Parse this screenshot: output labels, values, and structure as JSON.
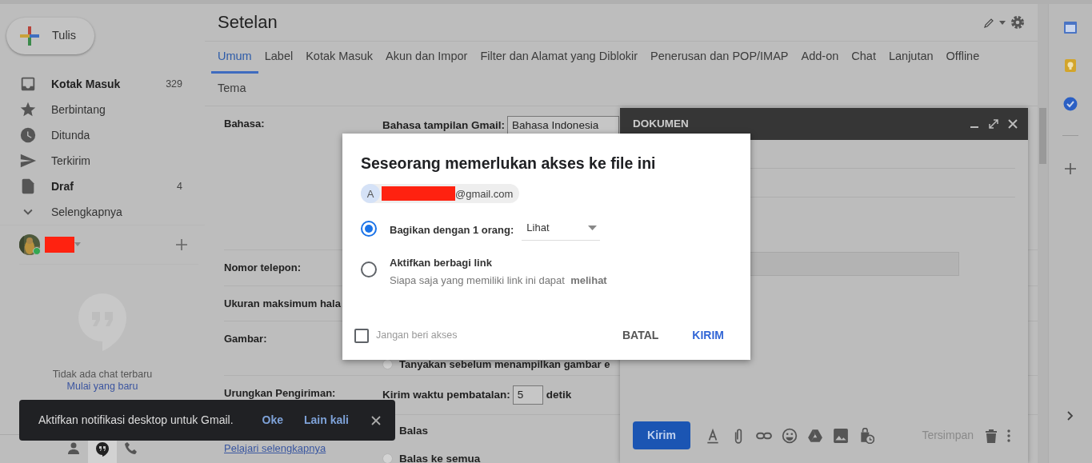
{
  "sidebar": {
    "compose_button": "Tulis",
    "items": [
      {
        "kind": "inbox",
        "label": "Kotak Masuk",
        "count": "329",
        "unread": true
      },
      {
        "kind": "star",
        "label": "Berbintang",
        "unread": false
      },
      {
        "kind": "clock",
        "label": "Ditunda",
        "unread": false
      },
      {
        "kind": "send",
        "label": "Terkirim",
        "unread": false
      },
      {
        "kind": "draft",
        "label": "Draf",
        "count": "4",
        "unread": true
      },
      {
        "kind": "more",
        "label": "Selengkapnya",
        "unread": false
      }
    ],
    "hangouts": {
      "empty_text": "Tidak ada chat terbaru",
      "start_link": "Mulai yang baru"
    },
    "bottom_tabs": [
      {
        "kind": "people",
        "selected": false
      },
      {
        "kind": "chat",
        "selected": true
      },
      {
        "kind": "phone",
        "selected": false
      }
    ]
  },
  "settings": {
    "title": "Setelan",
    "tabs": [
      {
        "label": "Umum",
        "selected": true
      },
      {
        "label": "Label",
        "selected": false
      },
      {
        "label": "Kotak Masuk",
        "selected": false
      },
      {
        "label": "Akun dan Impor",
        "selected": false
      },
      {
        "label": "Filter dan Alamat yang Diblokir",
        "selected": false
      },
      {
        "label": "Penerusan dan POP/IMAP",
        "selected": false
      },
      {
        "label": "Add-on",
        "selected": false
      },
      {
        "label": "Chat",
        "selected": false
      },
      {
        "label": "Lanjutan",
        "selected": false
      },
      {
        "label": "Offline",
        "selected": false
      },
      {
        "label": "Tema",
        "selected": false
      }
    ],
    "rows": [
      {
        "kind": "select",
        "label": "Bahasa:",
        "field_label": "Bahasa tampilan Gmail:",
        "value": "Bahasa Indonesia"
      },
      {
        "kind": "plain",
        "label": "Nomor telepon:"
      },
      {
        "kind": "plain",
        "label": "Ukuran maksimum hala"
      },
      {
        "kind": "radios",
        "label": "Gambar:",
        "options": [
          {
            "label": "Tanyakan sebelum menampilkan gambar e",
            "selected": false
          }
        ]
      },
      {
        "kind": "select",
        "label": "Urungkan Pengiriman:",
        "field_label": "Kirim waktu pembatalan:",
        "value": "5",
        "unit": "detik"
      },
      {
        "kind": "radios",
        "link": "Pelajari selengkapnya",
        "options": [
          {
            "label": "Balas"
          },
          {
            "label": "Balas ke semua",
            "selected": false
          }
        ]
      }
    ]
  },
  "dialog": {
    "title": "Seseorang memerlukan akses ke file ini",
    "recipient": {
      "initial": "A",
      "email_suffix": "@gmail.com"
    },
    "options": [
      {
        "kind": "share",
        "label": "Bagikan dengan 1 orang:",
        "dropdown": "Lihat",
        "selected": true
      },
      {
        "kind": "link",
        "label": "Aktifkan berbagi link",
        "description": "Siapa saja yang memiliki link ini dapat  **melihat**",
        "selected": false
      }
    ],
    "deny_checkbox": {
      "label": "Jangan beri akses",
      "checked": false
    },
    "buttons": [
      {
        "kind": "cancel",
        "label": "BATAL"
      },
      {
        "kind": "primary",
        "label": "KIRIM"
      }
    ]
  },
  "compose": {
    "title": "DOKUMEN",
    "send_button": "Kirim",
    "status": "Tersimpan"
  },
  "snackbar": {
    "message": "Aktifkan notifikasi desktop untuk Gmail.",
    "actions": [
      "Oke",
      "Lain kali"
    ]
  }
}
